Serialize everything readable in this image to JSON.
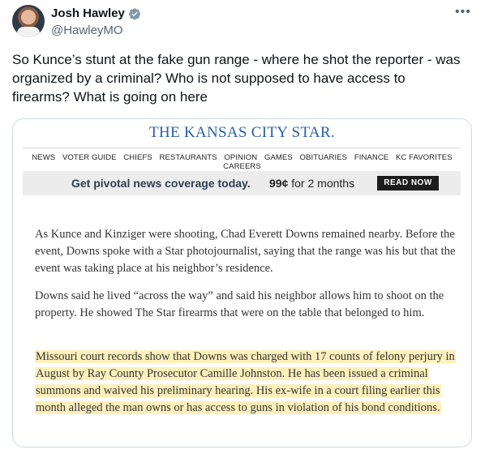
{
  "tweet": {
    "author_name": "Josh Hawley",
    "author_handle": "@HawleyMO",
    "more_icon": "more-options-icon",
    "verified_icon": "verified-badge-icon",
    "text": "So Kunce’s stunt at the fake gun range - where he shot the reporter - was organized by a criminal? Who is not supposed to have access to firearms? What is going on here"
  },
  "article": {
    "masthead": "THE KANSAS CITY STAR.",
    "nav": [
      "NEWS",
      "VOTER GUIDE",
      "CHIEFS",
      "RESTAURANTS",
      "OPINION",
      "GAMES",
      "OBITUARIES",
      "FINANCE",
      "KC FAVORITES",
      "CAREERS"
    ],
    "promo": {
      "text": "Get pivotal news coverage today.",
      "price_bold": "99¢",
      "price_rest": " for 2 months",
      "button": "READ NOW"
    },
    "paragraphs": [
      "As Kunce and Kinziger were shooting, Chad Everett Downs remained nearby. Before the event, Downs spoke with a Star photojournalist, saying that the range was his but that the event was taking place at his neighbor’s residence.",
      "Downs said he lived “across the way” and said his neighbor allows him to shoot on the property. He showed The Star firearms that were on the table that belonged to him.",
      "Missouri court records show that Downs was charged with 17 counts of felony perjury in August by Ray County Prosecutor Camille Johnston. He has been issued a criminal summons and waived his preliminary hearing. His ex-wife in a court filing earlier this month alleged the man owns or has access to guns in violation of his bond conditions."
    ],
    "highlight_color": "#fde896"
  }
}
